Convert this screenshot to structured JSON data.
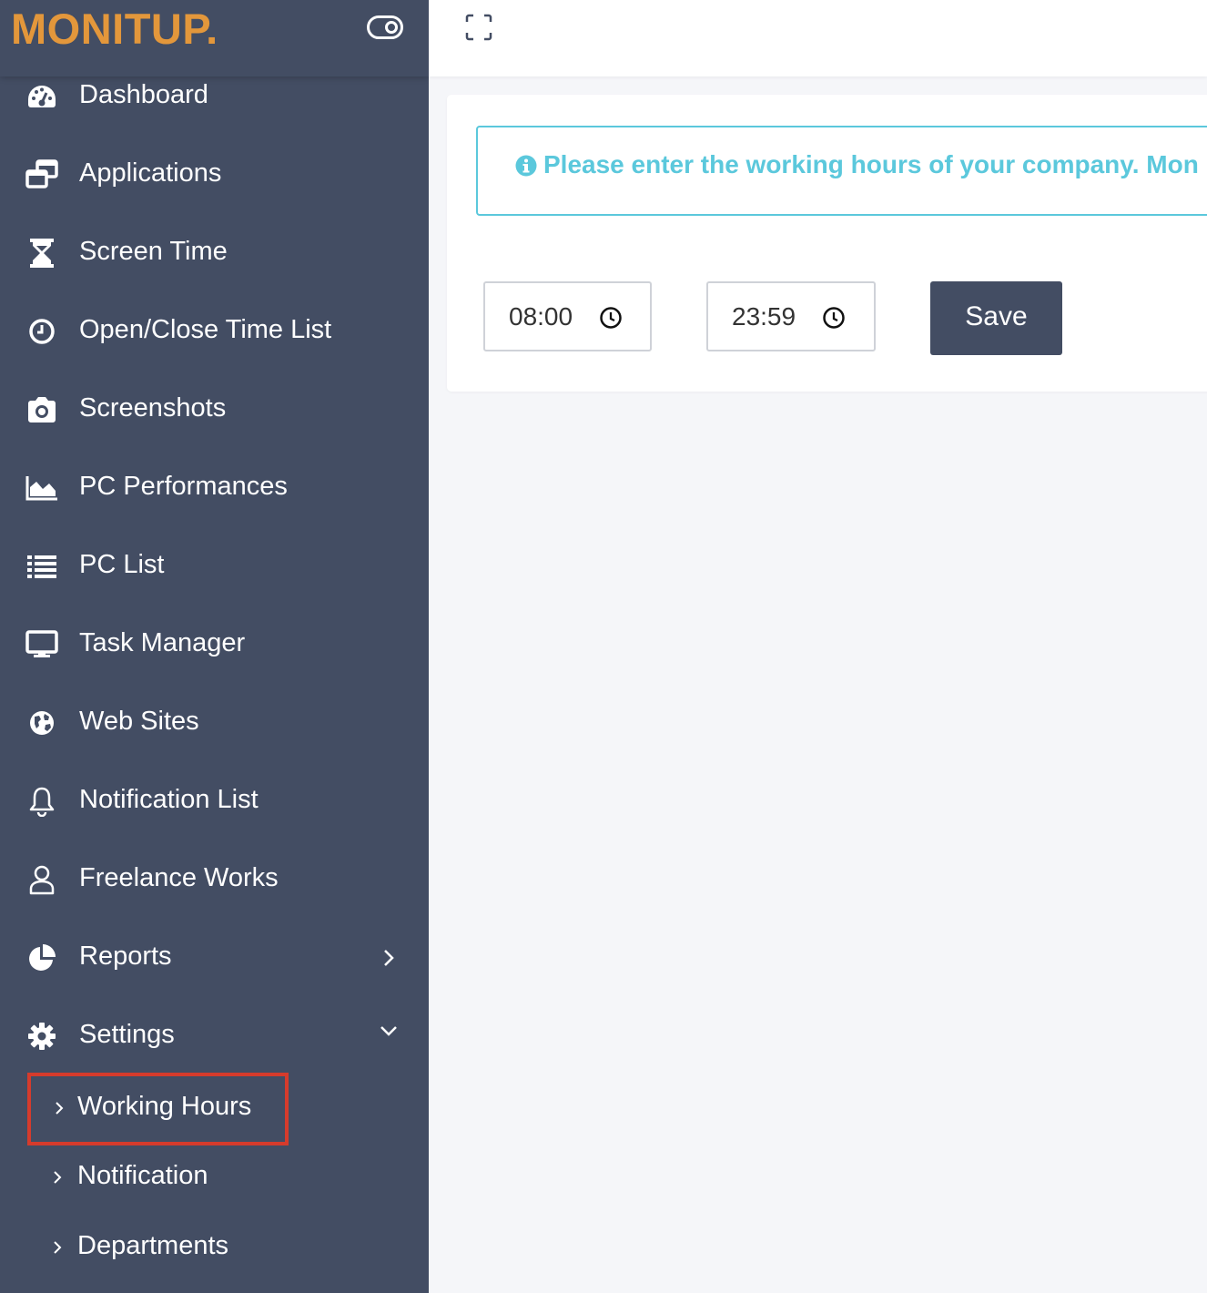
{
  "brand": {
    "logo_text": "MONITUP.",
    "accent_color": "#e3973b"
  },
  "sidebar": {
    "background_color": "#434d63",
    "items": [
      {
        "label": "Dashboard",
        "icon": "dashboard-gauge-icon"
      },
      {
        "label": "Applications",
        "icon": "applications-windows-icon"
      },
      {
        "label": "Screen Time",
        "icon": "hourglass-icon"
      },
      {
        "label": "Open/Close Time List",
        "icon": "clock-icon"
      },
      {
        "label": "Screenshots",
        "icon": "camera-icon"
      },
      {
        "label": "PC Performances",
        "icon": "area-chart-icon"
      },
      {
        "label": "PC List",
        "icon": "list-icon"
      },
      {
        "label": "Task Manager",
        "icon": "monitor-icon"
      },
      {
        "label": "Web Sites",
        "icon": "globe-icon"
      },
      {
        "label": "Notification List",
        "icon": "bell-icon"
      },
      {
        "label": "Freelance Works",
        "icon": "user-icon"
      },
      {
        "label": "Reports",
        "icon": "pie-chart-icon",
        "arrow": "chevron-right-icon"
      },
      {
        "label": "Settings",
        "icon": "gear-icon",
        "arrow": "chevron-down-icon",
        "expanded": true
      }
    ],
    "settings_subitems": [
      {
        "label": "Working Hours",
        "highlighted": true
      },
      {
        "label": "Notification"
      },
      {
        "label": "Departments"
      }
    ]
  },
  "topbar": {
    "fullscreen_icon": "fullscreen-icon"
  },
  "main": {
    "alert_text": "Please enter the working hours of your company. Mon",
    "alert_color": "#5bc8dc",
    "start_time": "08:00",
    "end_time": "23:59",
    "save_label": "Save"
  }
}
